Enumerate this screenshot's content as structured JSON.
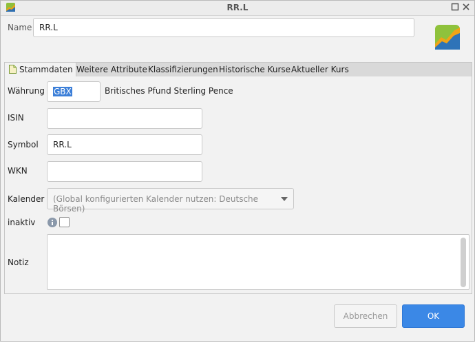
{
  "window": {
    "title": "RR.L"
  },
  "header": {
    "name_label": "Name",
    "name_value": "RR.L"
  },
  "tabs": [
    {
      "label": "Stammdaten",
      "active": true,
      "icon": "document-icon"
    },
    {
      "label": "Weitere Attribute"
    },
    {
      "label": "Klassifizierungen"
    },
    {
      "label": "Historische Kurse"
    },
    {
      "label": "Aktueller Kurs"
    }
  ],
  "form": {
    "currency_label": "Währung",
    "currency_code": "GBX",
    "currency_name": "Britisches Pfund Sterling Pence",
    "isin_label": "ISIN",
    "isin_value": "",
    "symbol_label": "Symbol",
    "symbol_value": "RR.L",
    "wkn_label": "WKN",
    "wkn_value": "",
    "calendar_label": "Kalender",
    "calendar_value": "(Global konfigurierten Kalender nutzen: Deutsche Börsen)",
    "inactive_label": "inaktiv",
    "inactive_checked": false,
    "notes_label": "Notiz",
    "notes_value": ""
  },
  "buttons": {
    "cancel": "Abbrechen",
    "ok": "OK"
  },
  "colors": {
    "accent": "#3b88e6",
    "selection": "#3c7fd8",
    "tab_bar": "#d9d9d9"
  }
}
